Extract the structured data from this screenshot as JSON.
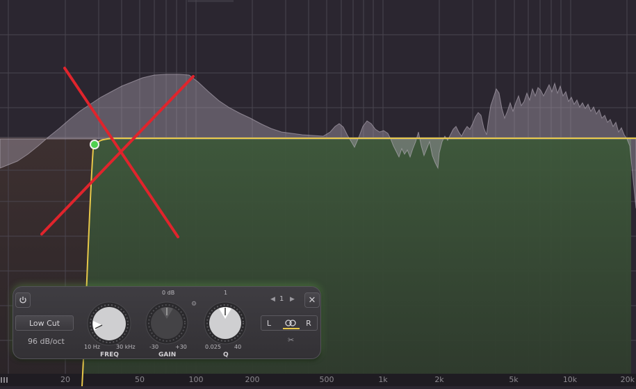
{
  "freq_axis": {
    "labels": [
      "20",
      "50",
      "100",
      "200",
      "500",
      "1k",
      "2k",
      "5k",
      "10k",
      "20k"
    ]
  },
  "band": {
    "shape": "Low Cut",
    "slope": "96 dB/oct",
    "number": "1",
    "freq": {
      "name": "FREQ",
      "min": "10 Hz",
      "max": "30 kHz"
    },
    "gain": {
      "name": "GAIN",
      "min": "-30",
      "max": "+30",
      "center": "0 dB"
    },
    "q": {
      "name": "Q",
      "min": "0.025",
      "max": "40",
      "center": "1"
    },
    "stereo": {
      "left": "L",
      "right": "R"
    }
  },
  "colors": {
    "curve": "#e8c84a",
    "node": "#4fd04f",
    "annotation": "#e0242c",
    "background": "#2b2630"
  }
}
